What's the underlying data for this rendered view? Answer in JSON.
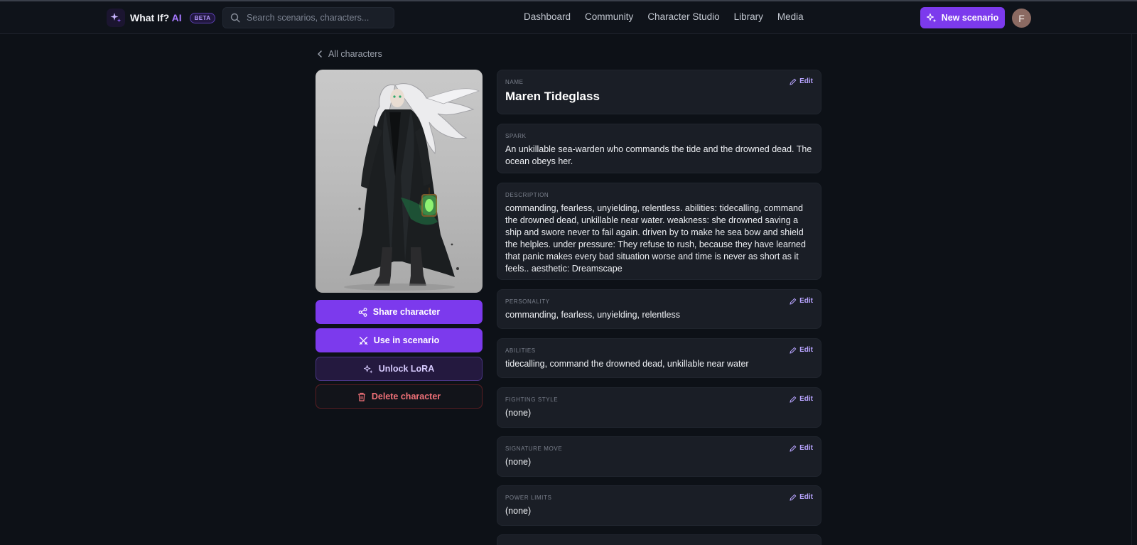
{
  "brand": {
    "name": "What If?",
    "ai": "AI",
    "badge": "BETA"
  },
  "search": {
    "placeholder": "Search scenarios, characters..."
  },
  "nav": {
    "links": [
      "Dashboard",
      "Community",
      "Character Studio",
      "Library",
      "Media"
    ]
  },
  "header": {
    "new_scenario": "New scenario",
    "avatar_initial": "F"
  },
  "back_link": "All characters",
  "actions": {
    "share": "Share character",
    "use": "Use in scenario",
    "lora": "Unlock LoRA",
    "delete": "Delete character"
  },
  "edit_label": "Edit",
  "fields": {
    "name": {
      "label": "NAME",
      "value": "Maren Tideglass"
    },
    "spark": {
      "label": "SPARK",
      "value": "An unkillable sea-warden who commands the tide and the drowned dead. The ocean obeys her."
    },
    "description": {
      "label": "DESCRIPTION",
      "value": "commanding, fearless, unyielding, relentless. abilities: tidecalling, command the drowned dead, unkillable near water. weakness: she drowned saving a ship and swore never to fail again. driven by to make he sea bow and shield the helples. under pressure: They refuse to rush, because they have learned that panic makes every bad situation worse and time is never as short as it feels.. aesthetic: Dreamscape"
    },
    "personality": {
      "label": "PERSONALITY",
      "value": "commanding, fearless, unyielding, relentless"
    },
    "abilities": {
      "label": "ABILITIES",
      "value": "tidecalling, command the drowned dead, unkillable near water"
    },
    "fighting_style": {
      "label": "FIGHTING STYLE",
      "value": "(none)"
    },
    "signature_move": {
      "label": "SIGNATURE MOVE",
      "value": "(none)"
    },
    "power_limits": {
      "label": "POWER LIMITS",
      "value": "(none)"
    }
  },
  "colors": {
    "accent": "#7c3aed",
    "background": "#0d1117",
    "card": "#1a1e26",
    "danger": "#f07178"
  }
}
